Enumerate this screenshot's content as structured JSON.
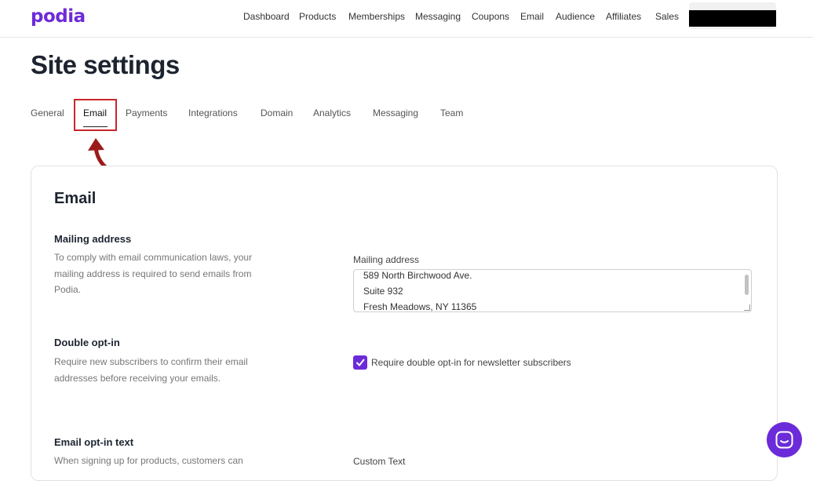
{
  "brand": {
    "logo_text": "podia",
    "accent_color": "#6c2bd9"
  },
  "nav": {
    "items": [
      "Dashboard",
      "Products",
      "Memberships",
      "Messaging",
      "Coupons",
      "Email",
      "Audience",
      "Affiliates",
      "Sales"
    ],
    "account_redacted": true
  },
  "page": {
    "title": "Site settings"
  },
  "tabs": {
    "items": [
      "General",
      "Email",
      "Payments",
      "Integrations",
      "Domain",
      "Analytics",
      "Messaging",
      "Team"
    ],
    "active": "Email"
  },
  "annotation": {
    "highlight_color": "#c8252b",
    "arrow_icon": "curved-arrow-up-icon"
  },
  "card": {
    "title": "Email",
    "mailing": {
      "title": "Mailing address",
      "desc_lines": [
        "To comply with email communication laws, your",
        "mailing address is required to send emails from",
        "Podia."
      ],
      "field_label": "Mailing address",
      "address_lines": [
        "589 North Birchwood Ave.",
        "Suite 932",
        "Fresh Meadows, NY 11365"
      ]
    },
    "double_opt_in": {
      "title": "Double opt-in",
      "desc_lines": [
        "Require new subscribers to confirm their email",
        "addresses before receiving your emails."
      ],
      "checkbox_label": "Require double opt-in for newsletter subscribers",
      "checked": true
    },
    "opt_in_text": {
      "title": "Email opt-in text",
      "desc_line": "When signing up for products, customers can",
      "field_label": "Custom Text"
    }
  },
  "chat": {
    "icon": "chat-bubble-icon"
  }
}
